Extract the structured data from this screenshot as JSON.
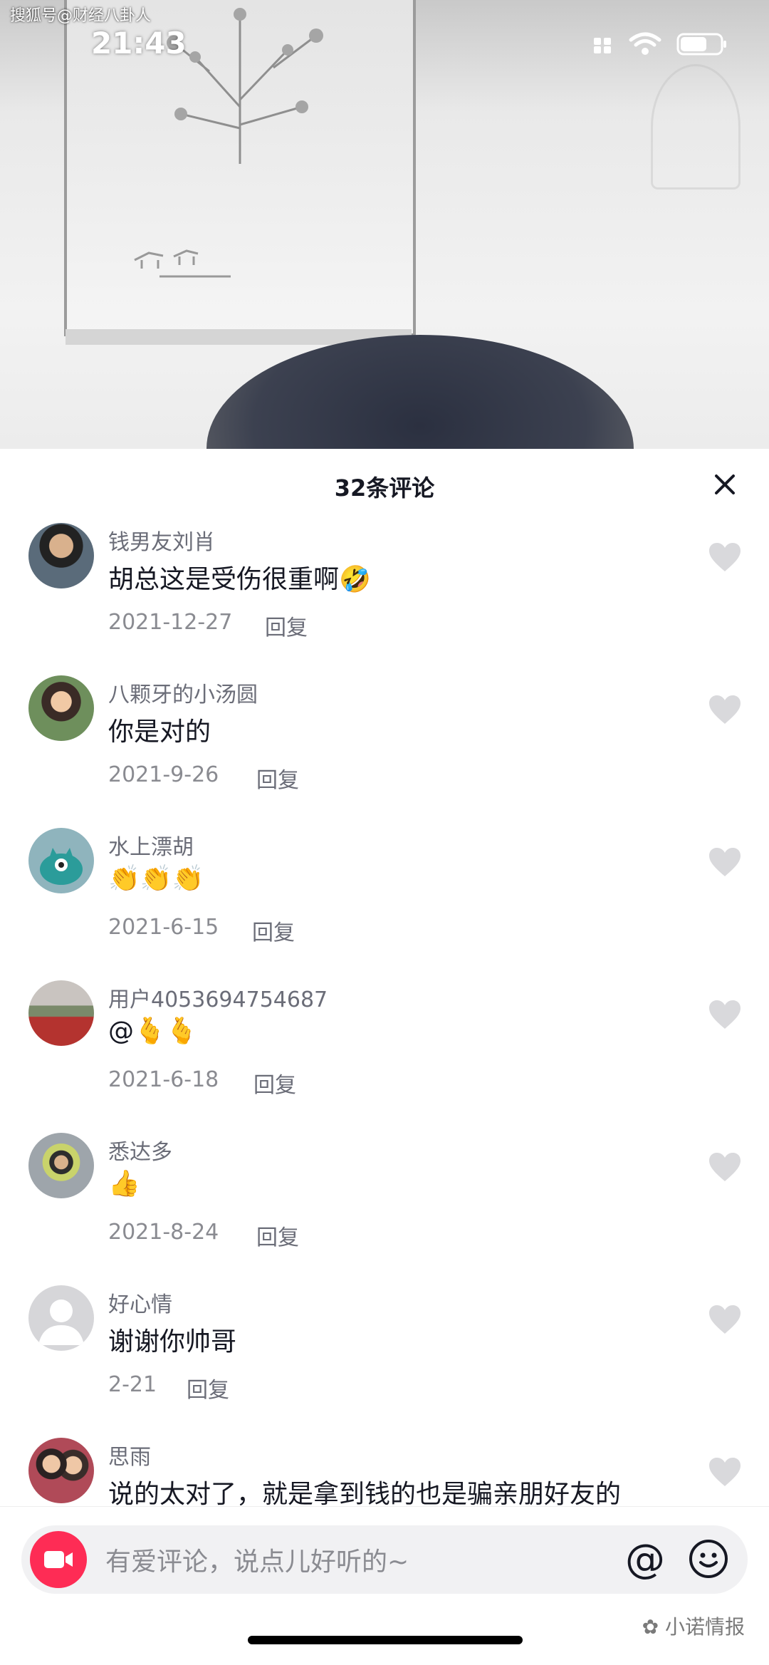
{
  "watermark_top": "搜狐号@财经八卦人",
  "status_bar": {
    "time": "21:43"
  },
  "sheet": {
    "title": "32条评论"
  },
  "comments": [
    {
      "user": "钱男友刘肖",
      "text": "胡总这是受伤很重啊🤣",
      "date": "2021-12-27",
      "reply": "回复"
    },
    {
      "user": "八颗牙的小汤圆",
      "text": "你是对的",
      "date": "2021-9-26",
      "reply": "回复"
    },
    {
      "user": "水上漂胡",
      "text": "👏👏👏",
      "date": "2021-6-15",
      "reply": "回复"
    },
    {
      "user": "用户4053694754687",
      "text": "@🫰🫰",
      "date": "2021-6-18",
      "reply": "回复"
    },
    {
      "user": "悉达多",
      "text": "👍",
      "date": "2021-8-24",
      "reply": "回复"
    },
    {
      "user": "好心情",
      "text": "谢谢你帅哥",
      "date": "2-21",
      "reply": "回复"
    },
    {
      "user": "思雨",
      "text": "说的太对了，就是拿到钱的也是骗亲朋好友的",
      "date": "",
      "reply": ""
    }
  ],
  "input": {
    "placeholder": "有爱评论，说点儿好听的~",
    "at_symbol": "@"
  },
  "watermark_bottom": "小诺情报",
  "colors": {
    "accent": "#fe2c55",
    "text_primary": "#161823",
    "text_secondary": "#8a8b91"
  }
}
